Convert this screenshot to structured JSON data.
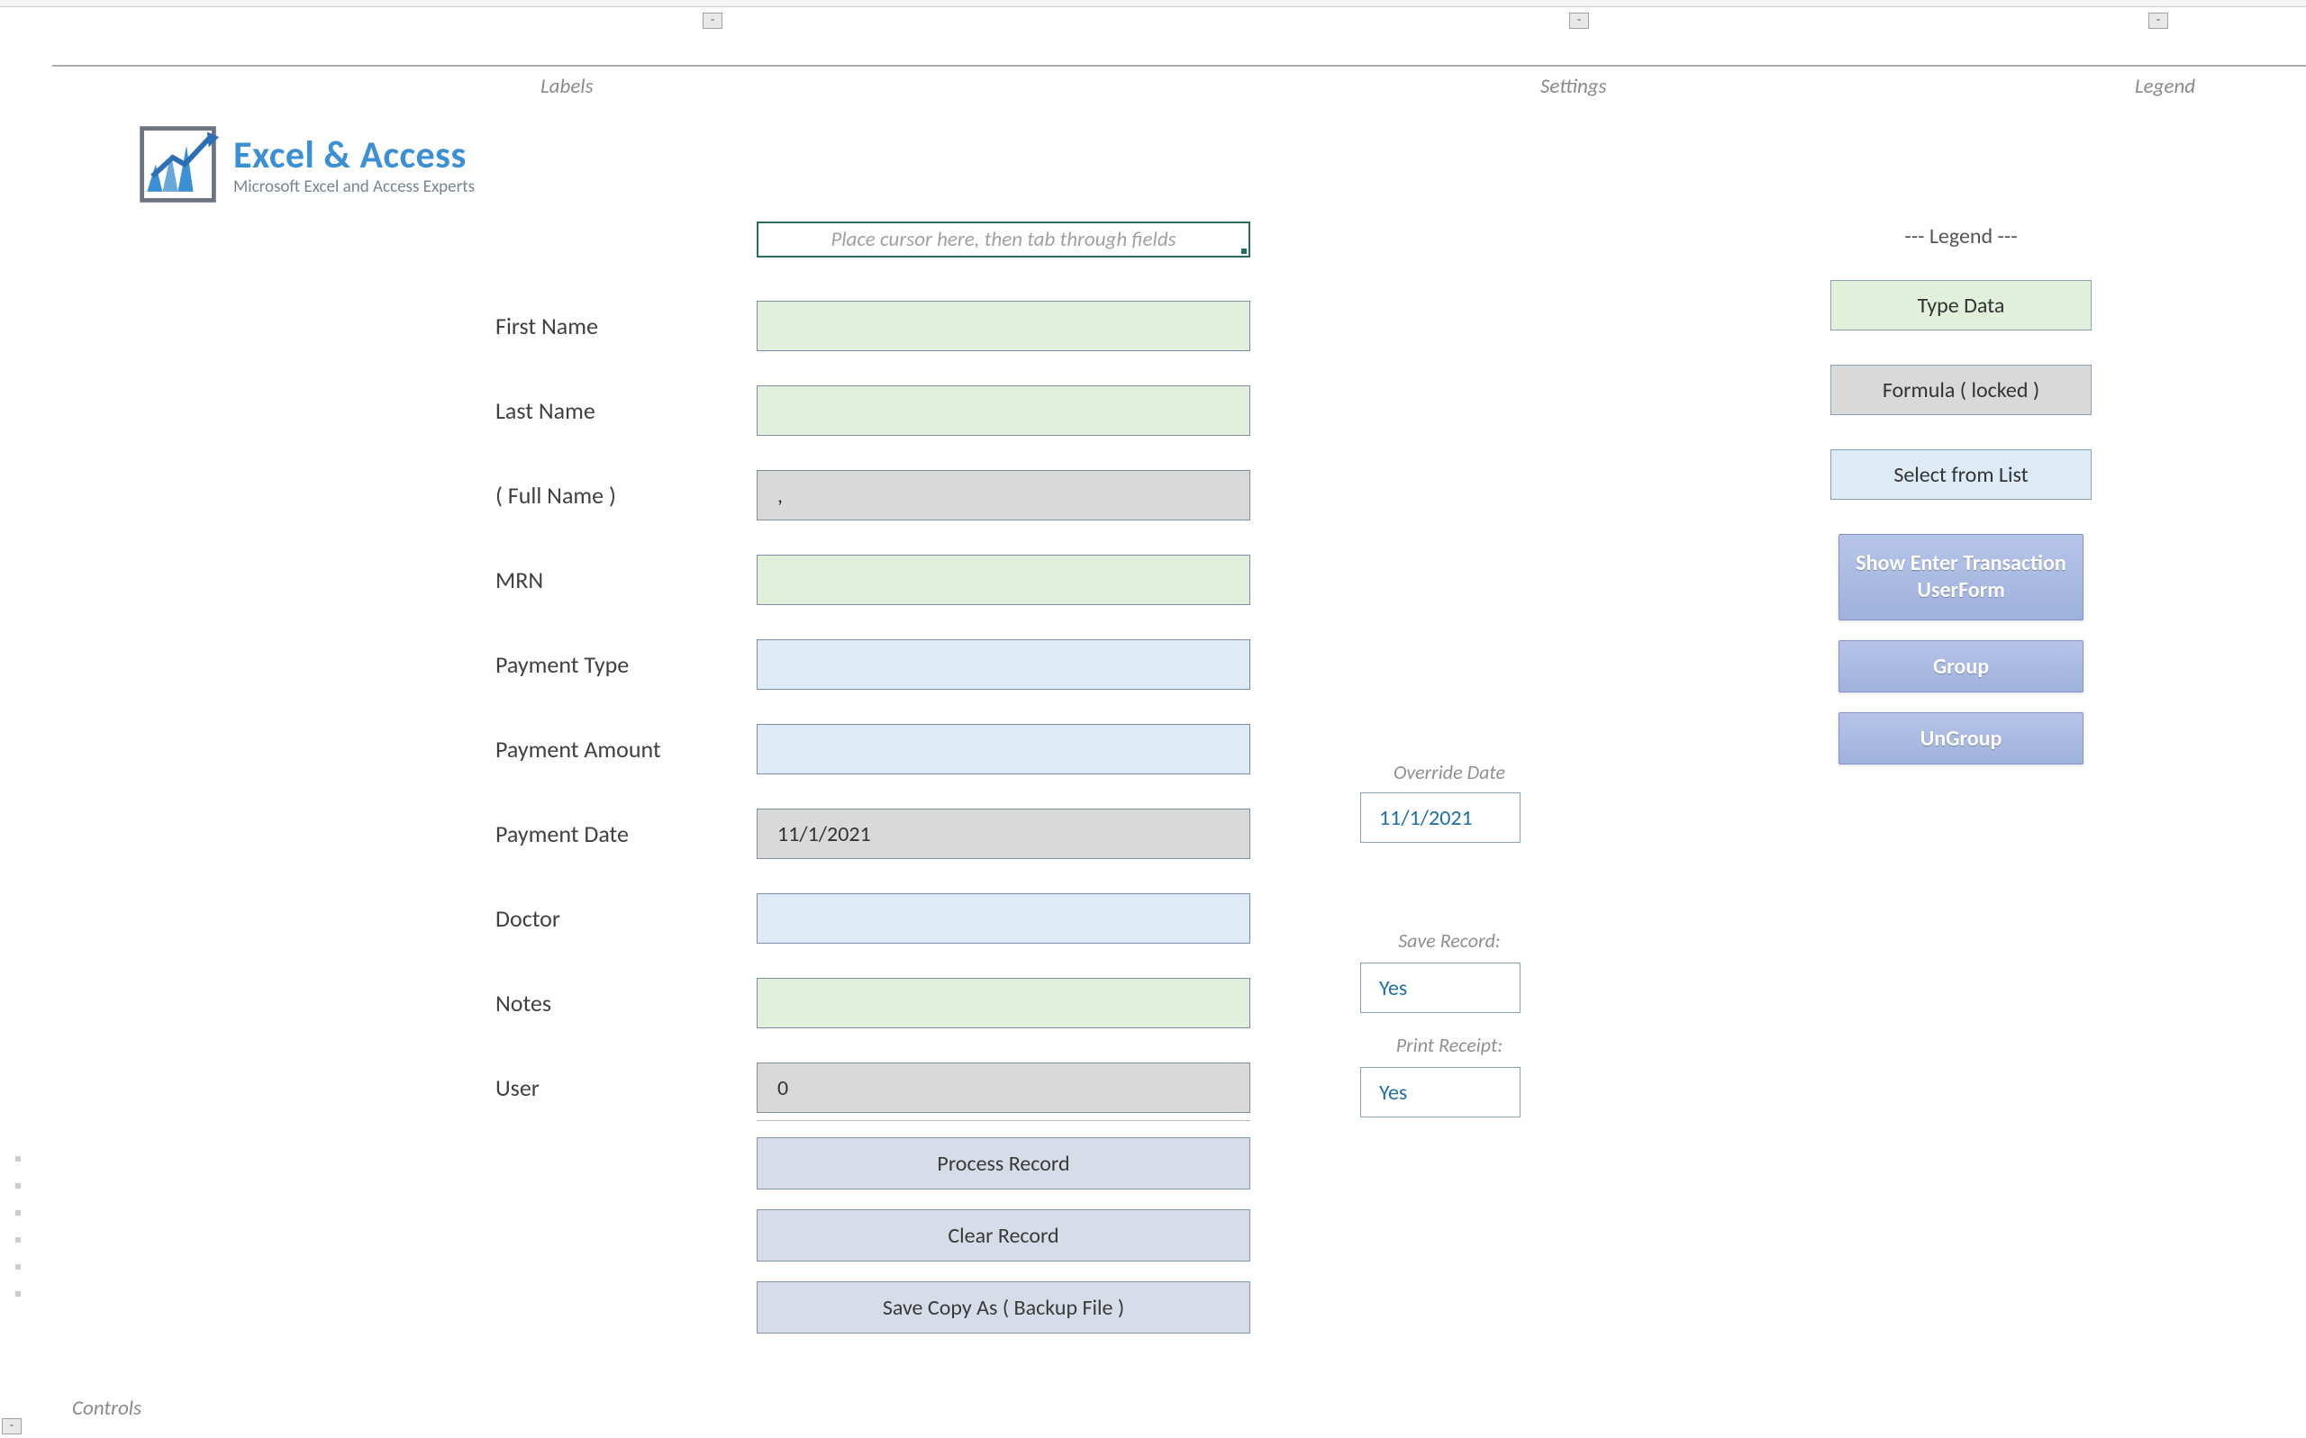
{
  "header": {
    "labels": "Labels",
    "settings": "Settings",
    "legend": "Legend",
    "controls": "Controls"
  },
  "logo": {
    "title": "Excel & Access",
    "subtitle": "Microsoft Excel and Access Experts"
  },
  "instruction": "Place cursor here, then tab through fields",
  "labels": {
    "first_name": "First Name",
    "last_name": "Last Name",
    "full_name": "( Full Name )",
    "mrn": "MRN",
    "payment_type": "Payment Type",
    "payment_amount": "Payment Amount",
    "payment_date": "Payment Date",
    "doctor": "Doctor",
    "notes": "Notes",
    "user": "User"
  },
  "values": {
    "first_name": "",
    "last_name": "",
    "full_name": ",",
    "mrn": "",
    "payment_type": "",
    "payment_amount": "",
    "payment_date": "11/1/2021",
    "doctor": "",
    "notes": "",
    "user": "0"
  },
  "side": {
    "override_label": "Override Date",
    "override_value": "11/1/2021",
    "save_label": "Save Record:",
    "save_value": "Yes",
    "print_label": "Print Receipt:",
    "print_value": "Yes"
  },
  "buttons": {
    "process": "Process Record",
    "clear": "Clear Record",
    "backup": "Save Copy As ( Backup File )"
  },
  "legend": {
    "title": "---   Legend   ---",
    "type_data": "Type Data",
    "formula": "Formula ( locked )",
    "select": "Select from List",
    "show_form": "Show Enter Transaction UserForm",
    "group": "Group",
    "ungroup": "UnGroup"
  },
  "toggle_glyph": "-"
}
